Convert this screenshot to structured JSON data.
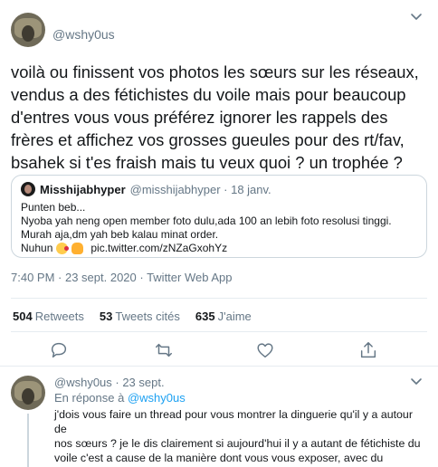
{
  "main_tweet": {
    "handle": "@wshy0us",
    "text": "voilà ou finissent vos photos les sœurs sur les réseaux,\nvendus a des fétichistes du voile mais pour beaucoup\nd'entres vous vous préférez ignorer les rappels des\nfrères et affichez vos grosses gueules pour des rt/fav,\nbsahek si t'es fraish mais tu veux quoi ? un trophée ?",
    "quote": {
      "name": "Misshijabhyper",
      "meta": "@misshijabhyper · 18 janv.",
      "body": "Punten beb...\nNyoba yah neng open member foto dulu,ada 100 an lebih foto resolusi tinggi.\nMurah aja,dm yah beb kalau minat order.",
      "last_line_prefix": "Nuhun",
      "link": "pic.twitter.com/zNZaGxohYz"
    },
    "timestamp": "7:40 PM · 23 sept. 2020 · Twitter Web App",
    "stats": {
      "retweets_count": "504",
      "retweets_label": "Retweets",
      "quotes_count": "53",
      "quotes_label": "Tweets cités",
      "likes_count": "635",
      "likes_label": "J'aime"
    },
    "actions": [
      "reply-icon",
      "retweet-icon",
      "like-icon",
      "share-icon"
    ]
  },
  "reply": {
    "handle_date": "@wshy0us · 23 sept.",
    "reply_prefix": "En réponse à",
    "reply_to": "@wshy0us",
    "text": "j'dois vous faire un thread pour vous montrer la dinguerie qu'il y a autour de\nnos sœurs ? je le dis clairement si aujourd'hui il y a autant de fétichiste du\nvoile c'est a cause de la manière dont vous vous exposer, avec du\nmaquillage, de manière non-légiférer"
  },
  "colors": {
    "accent": "#1da1f2",
    "secondary_text": "#657786",
    "border": "#ccd6dd"
  }
}
